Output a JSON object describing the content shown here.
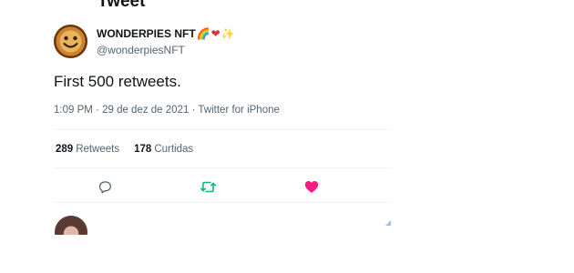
{
  "header": {
    "title": "Tweet"
  },
  "tweet": {
    "author": {
      "display_name": "WONDERPIES NFT",
      "badges": [
        "🌈",
        "❤",
        "✨"
      ],
      "handle": "@wonderpiesNFT",
      "avatar_icon": "smiley-pie-avatar"
    },
    "text": "First 500 retweets.",
    "meta": {
      "time": "1:09 PM",
      "separator1": "·",
      "date": "29 de dez de 2021",
      "separator2": "·",
      "source": "Twitter for iPhone"
    },
    "stats": {
      "retweets_count": "289",
      "retweets_label": "Retweets",
      "likes_count": "178",
      "likes_label": "Curtidas"
    },
    "actions": {
      "reply_icon": "reply-icon",
      "retweet_icon": "retweet-icon",
      "like_icon": "like-icon",
      "retweet_color": "#00ba7c",
      "like_color": "#f91880"
    }
  }
}
